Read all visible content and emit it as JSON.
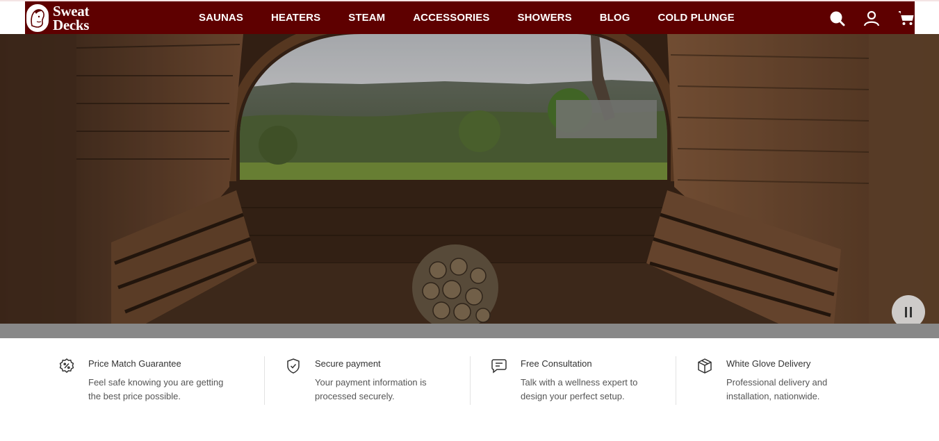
{
  "brand": {
    "line1": "Sweat",
    "line2": "Decks"
  },
  "nav": {
    "items": [
      {
        "label": "SAUNAS"
      },
      {
        "label": "HEATERS"
      },
      {
        "label": "STEAM"
      },
      {
        "label": "ACCESSORIES"
      },
      {
        "label": "SHOWERS"
      },
      {
        "label": "BLOG"
      },
      {
        "label": "COLD PLUNGE"
      }
    ],
    "icons": [
      "search-icon",
      "account-icon",
      "cart-icon"
    ]
  },
  "hero": {
    "media": "barrel sauna interior video with window view",
    "control": "pause-icon"
  },
  "features": [
    {
      "icon": "discount-badge-icon",
      "title": "Price Match Guarantee",
      "line1": "Feel safe knowing you are getting",
      "line2": "the best price possible."
    },
    {
      "icon": "shield-check-icon",
      "title": "Secure payment",
      "line1": "Your payment information is",
      "line2": "processed securely."
    },
    {
      "icon": "chat-icon",
      "title": "Free Consultation",
      "line1": "Talk with a wellness expert to",
      "line2": "design your perfect setup."
    },
    {
      "icon": "box-icon",
      "title": "White Glove Delivery",
      "line1": "Professional delivery and",
      "line2": "installation, nationwide."
    }
  ],
  "colors": {
    "brand": "#5e0000",
    "divider": "#e2e2e2",
    "text": "#333333"
  }
}
